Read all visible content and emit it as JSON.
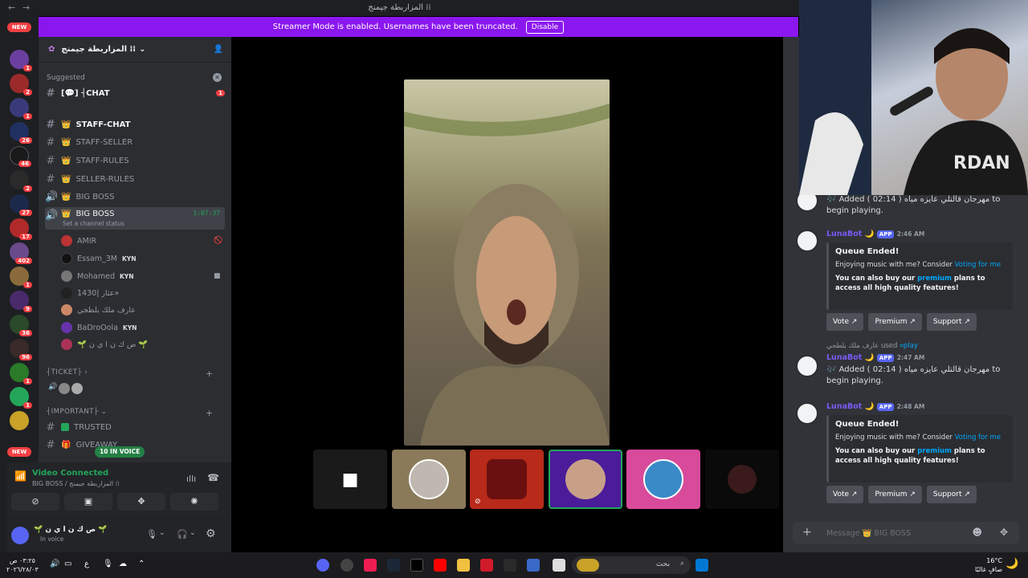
{
  "window": {
    "title": "المزاربطة جيمنج ⁞⁞"
  },
  "streamer": {
    "text": "Streamer Mode is enabled. Usernames have been truncated.",
    "disable_label": "Disable"
  },
  "rail": {
    "new_label": "NEW",
    "badges": [
      "1",
      "2",
      "1",
      "26",
      "46",
      "2",
      "27",
      "17",
      "402",
      "1",
      "9",
      "36",
      "96",
      "1",
      "1"
    ]
  },
  "server": {
    "name": "المزاربطة جيمنج ⁞⁞"
  },
  "sidebar": {
    "suggested_label": "Suggested",
    "suggested_channel": "[💬] ┤CHAT",
    "suggested_count": "1",
    "channels": [
      {
        "name": "STAFF-CHAT"
      },
      {
        "name": "STAFF-SELLER"
      },
      {
        "name": "STAFF-RULES"
      },
      {
        "name": "SELLER-RULES"
      },
      {
        "name": "BIG BOSS"
      },
      {
        "name": "BIG BOSS"
      }
    ],
    "voice_timer": "1:07:37",
    "channel_status": "Set a channel status",
    "members": [
      {
        "name": "AMIR"
      },
      {
        "name": "Essam_3M",
        "tag": "KYN"
      },
      {
        "name": "Mohamed",
        "tag": "KYN"
      },
      {
        "name": "عثار |1430»"
      },
      {
        "name": "عارف ملك بلطجي"
      },
      {
        "name": "BaDroOola",
        "tag": "KYN"
      },
      {
        "name": "🌱 ص ك ن ا ي ن 🌱"
      }
    ],
    "categories": [
      "┤TICKET├",
      "┤IMPORTANT├"
    ],
    "channels_after": [
      {
        "name": "TRUSTED"
      },
      {
        "name": "GIVEAWAY"
      }
    ],
    "in_voice_label": "10 IN VOICE"
  },
  "voice": {
    "status": "Video Connected",
    "location": "BIG BOSS / المزاربطة جيمنج ⁞⁞"
  },
  "user": {
    "name": "🌱 ص ك ن ا ي ن 🌱",
    "status": "In voice"
  },
  "chat": {
    "messages": [
      {
        "text": "🎶 Added ( 02:14 ) مهرجان قالتلي عايزه مياه to begin playing."
      },
      {
        "author": "LunaBot",
        "badge": "APP",
        "time": "2:46 AM",
        "embed_title": "Queue Ended!",
        "embed_body_pre": "Enjoying music with me? Consider",
        "embed_link": "Voting for me",
        "embed_bold_pre": "You can also buy our",
        "embed_bold_link": "premium",
        "embed_bold_post": "plans to access all high quality features!"
      },
      {
        "used_by": "عارف ملك بلطجي",
        "used_word": "used",
        "command": "play"
      },
      {
        "author": "LunaBot",
        "badge": "APP",
        "time": "2:47 AM",
        "text": "🎶 Added ( 02:14 ) مهرجان قالتلي عايزه مياه to begin playing."
      },
      {
        "author": "LunaBot",
        "badge": "APP",
        "time": "2:48 AM",
        "embed_title": "Queue Ended!",
        "embed_body_pre": "Enjoying music with me? Consider",
        "embed_link": "Voting for me",
        "embed_bold_pre": "You can also buy our",
        "embed_bold_link": "premium",
        "embed_bold_post": "plans to access all high quality features!"
      }
    ],
    "buttons": [
      "Vote",
      "Premium",
      "Support"
    ],
    "input_placeholder": "Message 👑 BIG BOSS"
  },
  "taskbar": {
    "time": "٠٣:٢٥ ص",
    "date": "٢٠٢٦/٢٨/٠٣",
    "search_placeholder": "بحث",
    "weather_temp": "16°C",
    "weather_desc": "صافٍ غالبًا",
    "lang": "ع"
  },
  "colors": {
    "brand": "#5865f2",
    "streamer": "#8b17ef",
    "online": "#23a55a",
    "danger": "#f23f43"
  }
}
